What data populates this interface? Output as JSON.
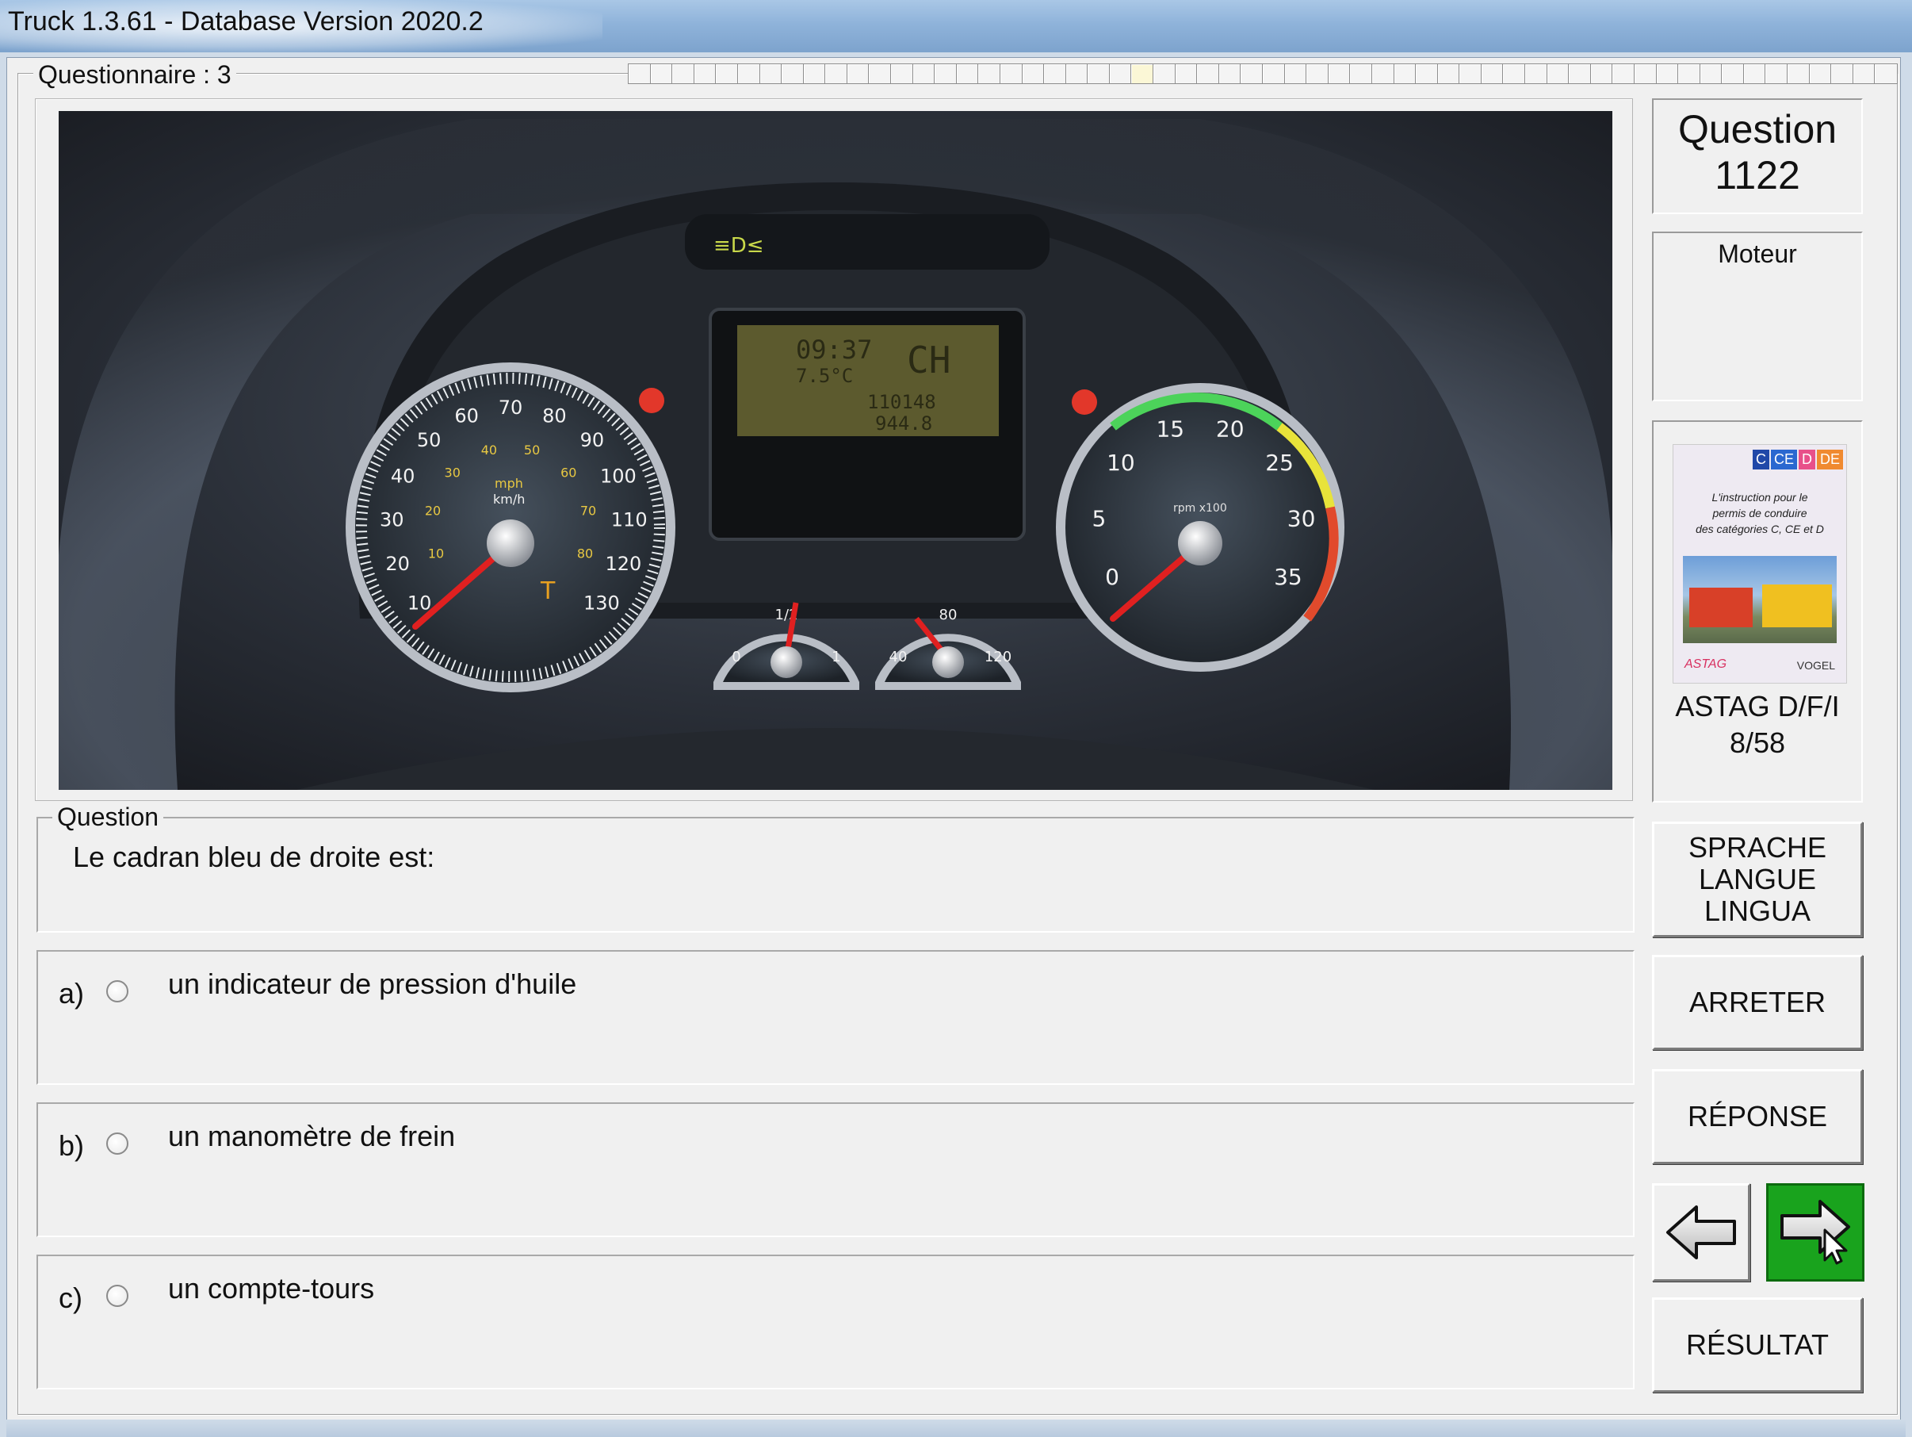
{
  "window": {
    "title": "Truck 1.3.61 - Database Version 2020.2"
  },
  "questionnaire": {
    "label": "Questionnaire : 3",
    "total_cells": 58,
    "current_cell": 23
  },
  "question_number": {
    "label": "Question",
    "number": "1122"
  },
  "category": "Moteur",
  "book": {
    "badges": [
      "C",
      "CE",
      "D",
      "DE"
    ],
    "title_lines": [
      "L'instruction pour le",
      "permis de conduire",
      "des catégories C, CE et D"
    ],
    "publisher_left": "ASTAG",
    "publisher_right": "VOGEL",
    "caption_line1": "ASTAG D/F/I",
    "caption_line2": "8/58"
  },
  "question": {
    "group_label": "Question",
    "text": "Le cadran bleu de droite est:"
  },
  "answers": [
    {
      "letter": "a)",
      "text": "un indicateur de pression d'huile"
    },
    {
      "letter": "b)",
      "text": "un manomètre de frein"
    },
    {
      "letter": "c)",
      "text": "un compte-tours"
    }
  ],
  "buttons": {
    "language_lines": [
      "SPRACHE",
      "LANGUE",
      "LINGUA"
    ],
    "stop": "ARRETER",
    "answer": "RÉPONSE",
    "result": "RÉSULTAT"
  },
  "dashboard": {
    "lcd_time": "09:37",
    "lcd_temp": "7.5°C",
    "lcd_country": "CH",
    "lcd_odometer_1": "110148",
    "lcd_odometer_2": "944.8",
    "speedo_kmh": [
      "10",
      "20",
      "30",
      "40",
      "50",
      "60",
      "70",
      "80",
      "90",
      "100",
      "110",
      "120",
      "130"
    ],
    "speedo_mph": [
      "10",
      "20",
      "30",
      "40",
      "50",
      "60",
      "70",
      "80"
    ],
    "speedo_unit_mph": "mph",
    "speedo_unit_kmh": "km/h",
    "rev_labels": [
      "0",
      "5",
      "10",
      "15",
      "20",
      "25",
      "30",
      "35"
    ],
    "rev_unit": "rpm x100",
    "fuel_labels": [
      "0",
      "1/2",
      "1"
    ],
    "temp_labels": [
      "40",
      "80",
      "120"
    ],
    "t_letter": "T"
  },
  "colors": {
    "answer_highlight": "#1fa31f",
    "title_bar": "#8fb3da"
  }
}
